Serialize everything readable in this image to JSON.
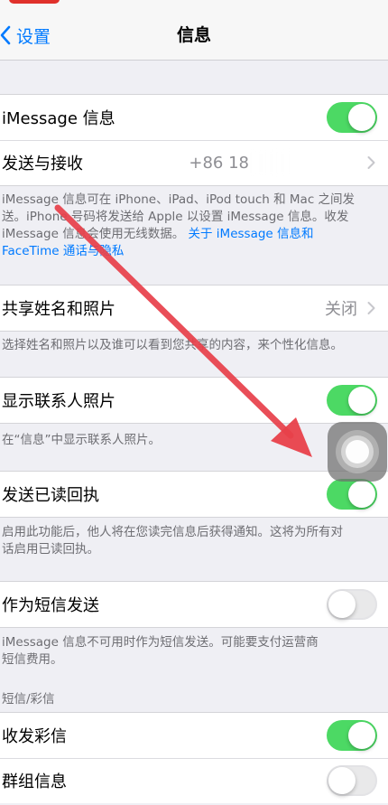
{
  "nav": {
    "back_label": "设置",
    "title": "信息"
  },
  "rows": {
    "imessage": {
      "label": "iMessage 信息",
      "toggle": "on"
    },
    "send_receive": {
      "label": "发送与接收",
      "value": "+86 18"
    },
    "share_name_photo": {
      "label": "共享姓名和照片",
      "value": "关闭"
    },
    "show_contact_photos": {
      "label": "显示联系人照片",
      "toggle": "on"
    },
    "send_read_receipts": {
      "label": "发送已读回执",
      "toggle": "on"
    },
    "send_as_sms": {
      "label": "作为短信发送",
      "toggle": "off"
    },
    "mms": {
      "label": "收发彩信",
      "toggle": "on"
    },
    "group_messaging": {
      "label": "群组信息",
      "toggle": "off"
    }
  },
  "footers": {
    "imessage_note_1": "iMessage 信息可在 iPhone、iPad、iPod touch 和 Mac 之间发",
    "imessage_note_2": "送。iPhone 号码将发送给 Apple 以设置 iMessage 信息。收发",
    "imessage_note_3": "iMessage 信息会使用无线数据。",
    "imessage_link_1": "关于 iMessage 信息和",
    "imessage_link_2": "FaceTime 通话与隐私",
    "share_note": "选择姓名和照片以及谁可以看到您共享的内容，来个性化信息。",
    "contact_photos_note": "在“信息”中显示联系人照片。",
    "read_receipts_note_1": "启用此功能后，他人将在您读完信息后获得通知。这将为所有对",
    "read_receipts_note_2": "话启用已读回执。",
    "sms_note_1": "iMessage 信息不可用时作为短信发送。可能要支付运营商",
    "sms_note_2": "短信费用。"
  },
  "sections": {
    "sms_mms_header": "短信/彩信"
  },
  "colors": {
    "accent": "#007aff",
    "toggle_on": "#4cd964",
    "annotation_arrow": "#e8404a"
  },
  "icons": {
    "back": "chevron-left-icon",
    "disclosure": "chevron-right-icon",
    "assistive_touch": "assistive-touch-icon",
    "annotation": "red-arrow-annotation"
  }
}
